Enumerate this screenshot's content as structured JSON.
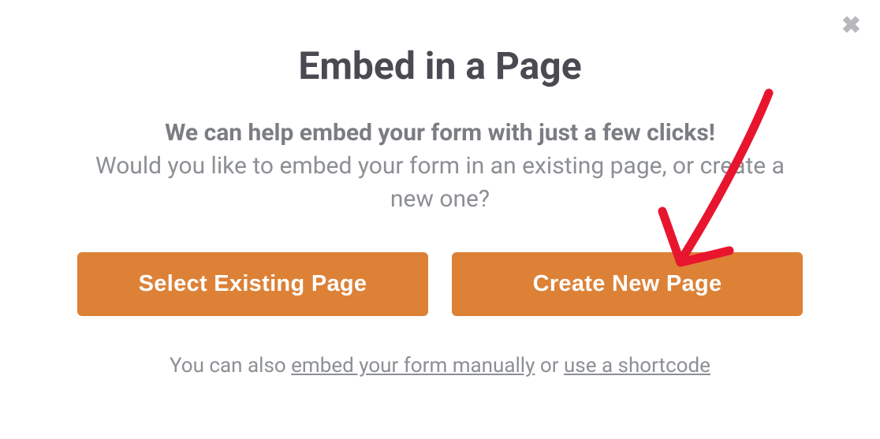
{
  "modal": {
    "title": "Embed in a Page",
    "subtitle_bold": "We can help embed your form with just a few clicks!",
    "subtitle_rest": "Would you like to embed your form in an existing page, or create a new one?",
    "button_existing": "Select Existing Page",
    "button_new": "Create New Page",
    "footer_prefix": "You can also ",
    "footer_link_manual": "embed your form manually",
    "footer_or": " or ",
    "footer_link_shortcode": "use a shortcode"
  },
  "annotation": {
    "arrow_color": "#e8152e"
  }
}
